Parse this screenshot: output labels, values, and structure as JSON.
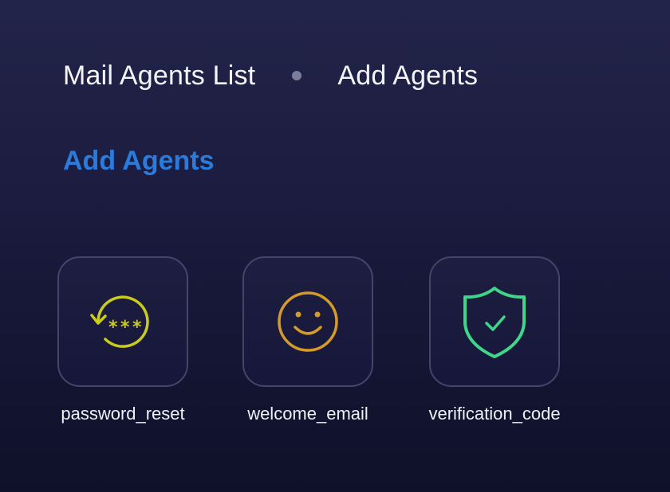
{
  "breadcrumb": {
    "items": [
      {
        "label": "Mail Agents List"
      },
      {
        "label": "Add Agents"
      }
    ]
  },
  "section": {
    "title": "Add Agents"
  },
  "agents": [
    {
      "label": "password_reset",
      "icon": "password-reset-icon",
      "color": "#c9cc1c"
    },
    {
      "label": "welcome_email",
      "icon": "smiley-icon",
      "color": "#d49a2a"
    },
    {
      "label": "verification_code",
      "icon": "shield-check-icon",
      "color": "#3fd68a"
    }
  ],
  "colors": {
    "background_top": "#23244a",
    "background_bottom": "#0f1029",
    "accent": "#2a7bdc",
    "tile_border": "#43456a"
  }
}
